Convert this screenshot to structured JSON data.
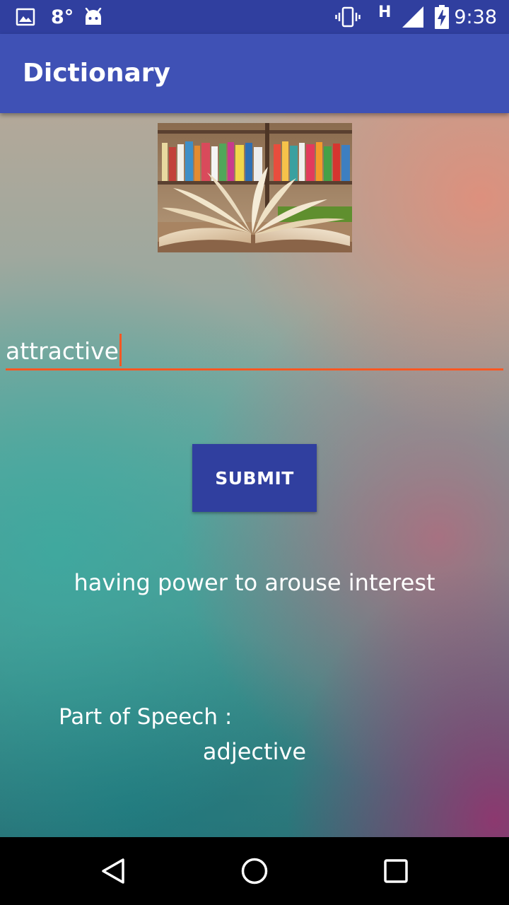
{
  "status_bar": {
    "temperature": "8°",
    "time": "9:38",
    "network_type": "H",
    "icons": [
      "gallery-notification-icon",
      "android-debug-icon",
      "vibrate-icon",
      "signal-icon",
      "battery-charging-icon"
    ]
  },
  "app_bar": {
    "title": "Dictionary",
    "color": "#3f51b5"
  },
  "form": {
    "word_value": "attractive",
    "submit_label": "SUBMIT",
    "accent_color": "#ff5722",
    "button_color": "#303f9f"
  },
  "result": {
    "definition": "having power to arouse interest",
    "pos_label": "Part of Speech :",
    "pos_value": "adjective"
  },
  "nav_bar": {
    "icons": [
      "back-icon",
      "home-icon",
      "recents-icon"
    ]
  }
}
